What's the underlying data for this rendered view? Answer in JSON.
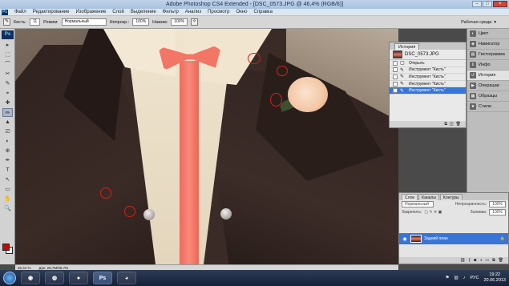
{
  "window": {
    "title": "Adobe Photoshop CS4 Extended - [DSC_0573.JPG @ 46,4% (RGB/8)]",
    "minimize": "–",
    "maximize": "□",
    "close": "×"
  },
  "menu": {
    "logo": "Ps",
    "items": [
      "Файл",
      "Редактирование",
      "Изображение",
      "Слой",
      "Выделение",
      "Фильтр",
      "Анализ",
      "Просмотр",
      "Окно",
      "Справка"
    ]
  },
  "options": {
    "brush_label": "Кисть:",
    "brush_size": "11",
    "mode_label": "Режим:",
    "mode_value": "Нормальный",
    "opacity_label": "Непрозр.:",
    "opacity_value": "100%",
    "flow_label": "Нажим:",
    "flow_value": "100%",
    "workspace_label": "Рабочая среда"
  },
  "toolbox": {
    "logo": "Ps",
    "tools": [
      "▸",
      "⬚",
      "⌒",
      "✂",
      "✎",
      "⌖",
      "✚",
      "✏",
      "▲",
      "⎚",
      "◐",
      "⊕",
      "✒",
      "T",
      "↖",
      "▭",
      "✋",
      "🔍"
    ],
    "active_index": 7,
    "fg_color": "#c20c0c",
    "bg_color": "#ffffff"
  },
  "history": {
    "tab_label": "История",
    "snapshot": "DSC_0573.JPG",
    "rows": [
      "Открыть",
      "Инструмент \"Кисть\"",
      "Инструмент \"Кисть\"",
      "Инструмент \"Кисть\"",
      "Инструмент \"Кисть\""
    ],
    "selected_index": 4
  },
  "dock": {
    "items": [
      {
        "icon": "◐",
        "label": "Цвет"
      },
      {
        "icon": "◈",
        "label": "Навигатор"
      },
      {
        "icon": "▤",
        "label": "Гистограмма"
      },
      {
        "icon": "ℹ",
        "label": "Инфо"
      },
      {
        "icon": "↺",
        "label": "История"
      },
      {
        "icon": "▶",
        "label": "Операции"
      },
      {
        "icon": "▦",
        "label": "Образцы"
      },
      {
        "icon": "★",
        "label": "Стили"
      }
    ],
    "active_index": 4
  },
  "layers": {
    "tabs": [
      "Слои",
      "Каналы",
      "Контуры"
    ],
    "active_tab": 0,
    "blend_mode": "Нормальный",
    "opacity_label": "Непрозрачность:",
    "opacity_value": "100%",
    "lock_label": "Закрепить:",
    "fill_label": "Заливка:",
    "fill_value": "100%",
    "layer_name": "Задний план",
    "lock_icon": "🔒"
  },
  "status": {
    "zoom": "46,44 %",
    "doc": "Док: 28,7M/28,7M"
  },
  "taskbar": {
    "apps": [
      "◉",
      "◍",
      "●",
      "Ps",
      "◕"
    ],
    "active_index": 3,
    "lang": "РУС",
    "time": "19:22",
    "date": "20.06.2013"
  }
}
